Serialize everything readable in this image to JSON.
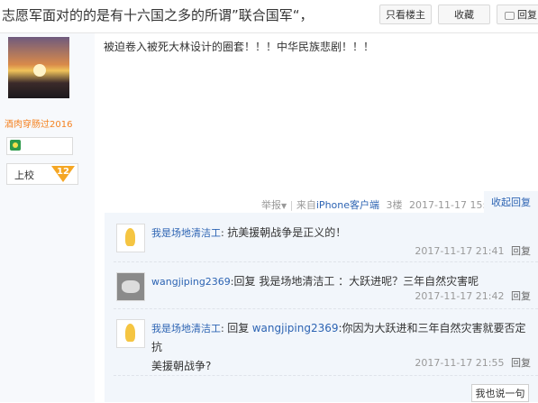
{
  "header": {
    "title": "志愿军面对的的是有十六国之多的所谓”联合国军“，",
    "only_op_label": "只看楼主",
    "favorite_label": "收藏",
    "reply_label": "回复"
  },
  "author": {
    "username": "酒肉穿肠过2016",
    "level_label": "上校",
    "level_number": "12"
  },
  "post": {
    "content": "被迫卷入被死大林设计的圈套！！！中华民族悲剧！！！",
    "report_label": "举报",
    "from_prefix": "来自",
    "client": "iPhone客户端",
    "floor": "3楼",
    "time": "2017-11-17 15:21",
    "collapse_reply_label": "收起回复"
  },
  "replies": [
    {
      "username": "我是场地清洁工",
      "colon": ":",
      "content": "抗美援朝战争是正义的！",
      "time": "2017-11-17 21:41",
      "reply_label": "回复"
    },
    {
      "username": "wangjiping2369",
      "colon": ":",
      "content": "回复 我是场地清洁工 ：大跃进呢？三年自然灾害呢",
      "time": "2017-11-17 21:42",
      "reply_label": "回复"
    },
    {
      "username": "我是场地清洁工",
      "colon": ":",
      "content_prefix": "回复",
      "mention": "wangjiping2369",
      "content_line1": ":你因为大跃进和三年自然灾害就要否定抗",
      "content_line2": "美援朝战争?",
      "time": "2017-11-17 21:55",
      "reply_label": "回复"
    }
  ],
  "say_button_label": "我也说一句",
  "colors": {
    "link": "#2d64b3",
    "username_orange": "#f58220",
    "meta_gray": "#999999",
    "reply_bg": "#f2f6fb"
  }
}
